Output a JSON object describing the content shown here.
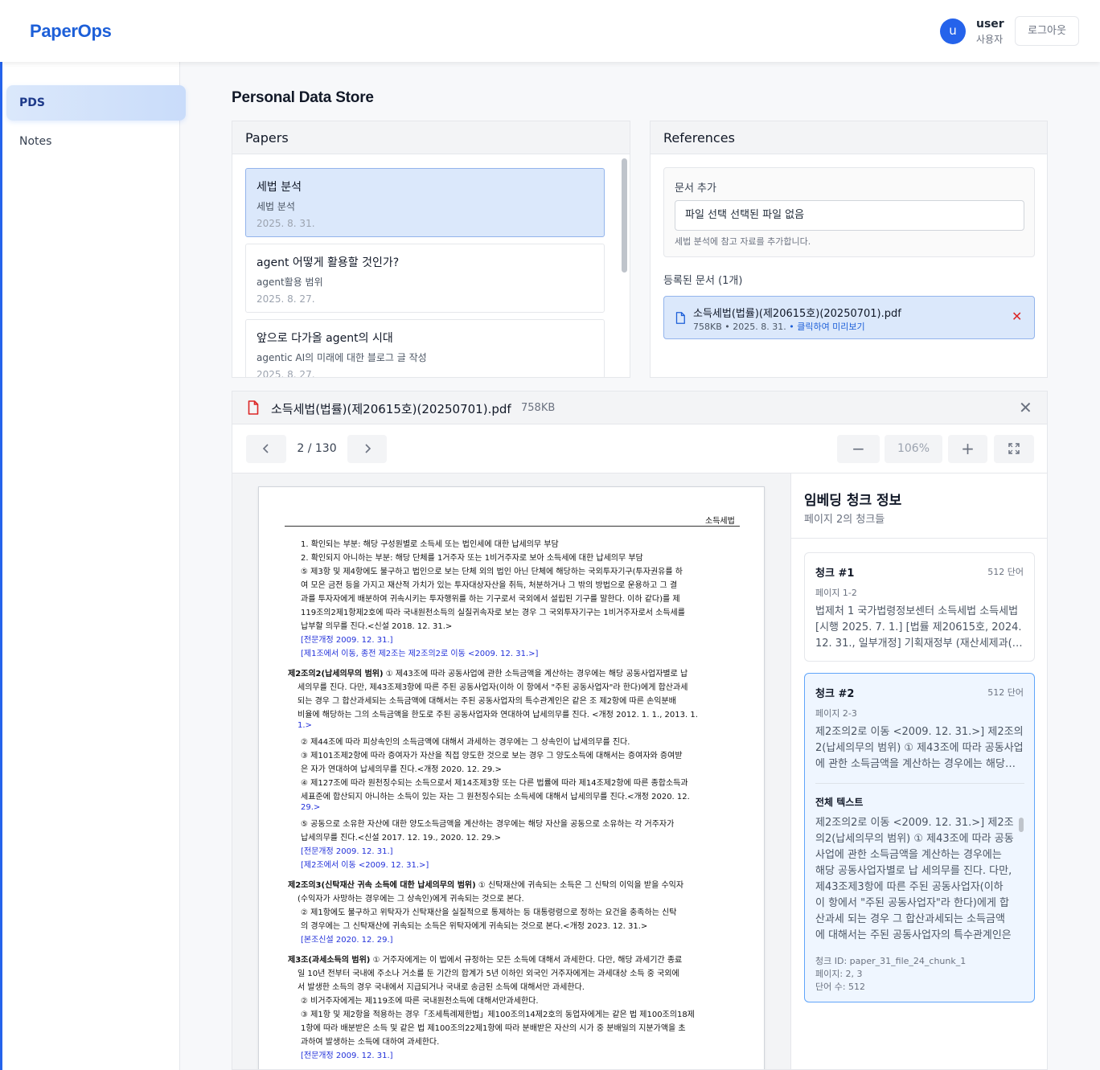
{
  "app": {
    "logo": "PaperOps"
  },
  "user": {
    "initial": "u",
    "name": "user",
    "role": "사용자",
    "logout_label": "로그아웃"
  },
  "sidebar": {
    "items": [
      {
        "label": "PDS",
        "active": true
      },
      {
        "label": "Notes",
        "active": false
      }
    ]
  },
  "page": {
    "title": "Personal Data Store"
  },
  "papers": {
    "heading": "Papers",
    "items": [
      {
        "title": "세법 분석",
        "subtitle": "세법 분석",
        "date": "2025. 8. 31.",
        "active": true
      },
      {
        "title": "agent 어떻게 활용할 것인가?",
        "subtitle": "agent활용 범위",
        "date": "2025. 8. 27.",
        "active": false
      },
      {
        "title": "앞으로 다가올 agent의 시대",
        "subtitle": "agentic AI의 미래에 대한 블로그 글 작성",
        "date": "2025. 8. 27.",
        "active": false
      }
    ]
  },
  "references": {
    "heading": "References",
    "add_label": "문서 추가",
    "file_input_text": "파일 선택 선택된 파일 없음",
    "add_help": "세법 분석에 참고 자료를 추가합니다.",
    "registered_label": "등록된 문서 (1개)",
    "docs": [
      {
        "name": "소득세법(법률)(제20615호)(20250701).pdf",
        "meta": "758KB • 2025. 8. 31.",
        "preview_label": "• 클릭하여 미리보기"
      }
    ]
  },
  "viewer": {
    "file_name": "소득세법(법률)(제20615호)(20250701).pdf",
    "file_size": "758KB",
    "close_icon": "close-icon",
    "page_indicator": "2 / 130",
    "zoom_label": "106%",
    "pdf_page": {
      "header": "소득세법",
      "lines": [
        {
          "text": "1. 확인되는 부분: 해당 구성원별로 소득세 또는 법인세에 대한 납세의무 부담",
          "style": ""
        },
        {
          "text": "2. 확인되지 아니하는 부분: 해당 단체를 1거주자 또는 1비거주자로 보아 소득세에 대한 납세의무 부담",
          "style": ""
        },
        {
          "text": "⑤ 제3항 및 제4항에도 불구하고 법인으로 보는 단체 외의 법인 아닌 단체에 해당하는 국외투자기구(투자권유를 하",
          "style": ""
        },
        {
          "text": "여 모은 금전 등을 가지고 재산적 가치가 있는 투자대상자산을 취득, 처분하거나 그 밖의 방법으로 운용하고 그 결",
          "style": ""
        },
        {
          "text": "과를 투자자에게 배분하여 귀속시키는 투자행위를 하는 기구로서 국외에서 설립된 기구를 말한다. 이하 같다)를 제",
          "style": ""
        },
        {
          "text": "119조의2제1항제2호에 따라 국내원천소득의 실질귀속자로 보는 경우 그 국외투자기구는 1비거주자로서 소득세를",
          "style": ""
        },
        {
          "text": "납부할 의무를 진다.<신설 2018. 12. 31.>",
          "style": ""
        },
        {
          "text": "[전문개정 2009. 12. 31.]",
          "style": "blue"
        },
        {
          "text": "[제1조에서 이동, 종전 제2조는 제2조의2로 이동 <2009. 12. 31.>]",
          "style": "blue"
        },
        {
          "text": "제2조의2(납세의무의 범위) ① 제43조에 따라 공동사업에 관한 소득금액을 계산하는 경우에는 해당 공동사업자별로 납",
          "style": ""
        },
        {
          "text": "세의무를 진다. 다만, 제43조제3항에 따른 주된 공동사업자(이하 이 항에서 \"주된 공동사업자\"라 한다)에게 합산과세",
          "style": ""
        },
        {
          "text": "되는 경우 그 합산과세되는 소득금액에 대해서는 주된 공동사업자의 특수관계인은 같은 조 제2항에 따른 손익분배",
          "style": ""
        },
        {
          "text": "비율에 해당하는 그의 소득금액을 한도로 주된 공동사업자와 연대하여 납세의무를 진다. <개정 2012. 1. 1., 2013. 1.",
          "style": ""
        },
        {
          "text": "1.>",
          "style": "blue"
        },
        {
          "text": "② 제44조에 따라 피상속인의 소득금액에 대해서 과세하는 경우에는 그 상속인이 납세의무를 진다.",
          "style": ""
        },
        {
          "text": "③ 제101조제2항에 따라 증여자가 자산을 직접 양도한 것으로 보는 경우 그 양도소득에 대해서는 증여자와 증여받",
          "style": ""
        },
        {
          "text": "은 자가 연대하여 납세의무를 진다.<개정 2020. 12. 29.>",
          "style": ""
        },
        {
          "text": "④ 제127조에 따라 원천징수되는 소득으로서 제14조제3항 또는 다른 법률에 따라 제14조제2항에 따른 종합소득과",
          "style": ""
        },
        {
          "text": "세표준에 합산되지 아니하는 소득이 있는 자는 그 원천징수되는 소득세에 대해서 납세의무를 진다.<개정 2020. 12.",
          "style": ""
        },
        {
          "text": "29.>",
          "style": "blue"
        },
        {
          "text": "⑤ 공동으로 소유한 자산에 대한 양도소득금액을 계산하는 경우에는 해당 자산을 공동으로 소유하는 각 거주자가",
          "style": ""
        },
        {
          "text": "납세의무를 진다.<신설 2017. 12. 19., 2020. 12. 29.>",
          "style": ""
        },
        {
          "text": "[전문개정 2009. 12. 31.]",
          "style": "blue"
        },
        {
          "text": "[제2조에서 이동 <2009. 12. 31.>]",
          "style": "blue"
        },
        {
          "text": "제2조의3(신탁재산 귀속 소득에 대한 납세의무의 범위) ① 신탁재산에 귀속되는 소득은 그 신탁의 이익을 받을 수익자",
          "style": ""
        },
        {
          "text": "(수익자가 사망하는 경우에는 그 상속인)에게 귀속되는 것으로 본다.",
          "style": ""
        },
        {
          "text": "② 제1항에도 불구하고 위탁자가 신탁재산을 실질적으로 통제하는 등 대통령령으로 정하는 요건을 충족하는 신탁",
          "style": ""
        },
        {
          "text": "의 경우에는 그 신탁재산에 귀속되는 소득은 위탁자에게 귀속되는 것으로 본다.<개정 2023. 12. 31.>",
          "style": ""
        },
        {
          "text": "[본조신설 2020. 12. 29.]",
          "style": "blue"
        },
        {
          "text": "제3조(과세소득의 범위) ① 거주자에게는 이 법에서 규정하는 모든 소득에 대해서 과세한다. 다만, 해당 과세기간 종료",
          "style": ""
        },
        {
          "text": "일 10년 전부터 국내에 주소나 거소를 둔 기간의 합계가 5년 이하인 외국인 거주자에게는 과세대상 소득 중 국외에",
          "style": ""
        },
        {
          "text": "서 발생한 소득의 경우 국내에서 지급되거나 국내로 송금된 소득에 대해서만 과세한다.",
          "style": ""
        },
        {
          "text": "② 비거주자에게는 제119조에 따른 국내원천소득에 대해서만과세한다.",
          "style": ""
        },
        {
          "text": "③ 제1항 및 제2항을 적용하는 경우「조세특례제한법」제100조의14제2호의 동업자에게는 같은 법 제100조의18제",
          "style": ""
        },
        {
          "text": "1항에 따라 배분받은 소득 및 같은 법 제100조의22제1항에 따라 분배받은 자산의 시가 중 분배일의 지분가액을 초",
          "style": ""
        },
        {
          "text": "과하여 발생하는 소득에 대하여 과세한다.",
          "style": ""
        },
        {
          "text": "[전문개정 2009. 12. 31.]",
          "style": "blue"
        }
      ]
    }
  },
  "chunks": {
    "title": "임베딩 청크 정보",
    "subtitle": "페이지 2의 청크들",
    "items": [
      {
        "title": "청크 #1",
        "words": "512 단어",
        "pages": "페이지 1-2",
        "preview": "법제처 1 국가법령정보센터 소득세법 소득세법 [시행 2025. 7. 1.] [법률 제20615호, 2024. 12. 31., 일부개정] 기획재정부 (재산세제과(…"
      },
      {
        "title": "청크 #2",
        "words": "512 단어",
        "pages": "페이지 2-3",
        "preview": "제2조의2로 이동 <2009. 12. 31.>] 제2조의2(납세의무의 범위) ① 제43조에 따라 공동사업에 관한 소득금액을 계산하는 경우에는 해당…",
        "full_label": "전체 텍스트",
        "full_text": "제2조의2로 이동 <2009. 12. 31.>] 제2조의2(납세의무의 범위) ① 제43조에 따라 공동사업에 관한 소득금액을 계산하는 경우에는 해당 공동사업자별로 납 세의무를 진다. 다만, 제43조제3항에 따른 주된 공동사업자(이하 이 항에서 \"주된 공동사업자\"라 한다)에게 합산과세 되는 경우 그 합산과세되는 소득금액에 대해서는 주된 공동사업자의 특수관계인은",
        "chunk_id": "청크 ID: paper_31_file_24_chunk_1",
        "pages_meta": "페이지: 2, 3",
        "word_meta": "단어 수: 512"
      }
    ]
  }
}
